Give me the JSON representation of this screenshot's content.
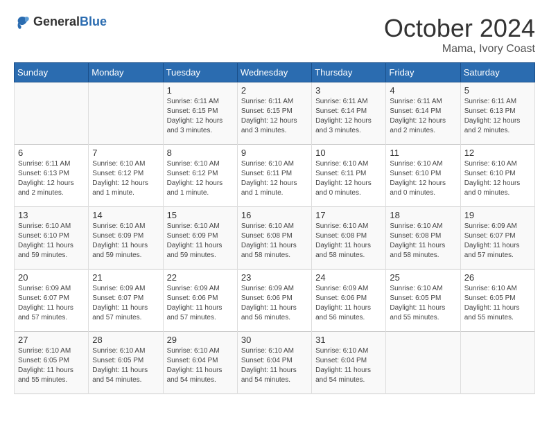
{
  "logo": {
    "general": "General",
    "blue": "Blue"
  },
  "header": {
    "month": "October 2024",
    "location": "Mama, Ivory Coast"
  },
  "days_of_week": [
    "Sunday",
    "Monday",
    "Tuesday",
    "Wednesday",
    "Thursday",
    "Friday",
    "Saturday"
  ],
  "weeks": [
    [
      {
        "day": "",
        "info": ""
      },
      {
        "day": "",
        "info": ""
      },
      {
        "day": "1",
        "info": "Sunrise: 6:11 AM\nSunset: 6:15 PM\nDaylight: 12 hours and 3 minutes."
      },
      {
        "day": "2",
        "info": "Sunrise: 6:11 AM\nSunset: 6:15 PM\nDaylight: 12 hours and 3 minutes."
      },
      {
        "day": "3",
        "info": "Sunrise: 6:11 AM\nSunset: 6:14 PM\nDaylight: 12 hours and 3 minutes."
      },
      {
        "day": "4",
        "info": "Sunrise: 6:11 AM\nSunset: 6:14 PM\nDaylight: 12 hours and 2 minutes."
      },
      {
        "day": "5",
        "info": "Sunrise: 6:11 AM\nSunset: 6:13 PM\nDaylight: 12 hours and 2 minutes."
      }
    ],
    [
      {
        "day": "6",
        "info": "Sunrise: 6:11 AM\nSunset: 6:13 PM\nDaylight: 12 hours and 2 minutes."
      },
      {
        "day": "7",
        "info": "Sunrise: 6:10 AM\nSunset: 6:12 PM\nDaylight: 12 hours and 1 minute."
      },
      {
        "day": "8",
        "info": "Sunrise: 6:10 AM\nSunset: 6:12 PM\nDaylight: 12 hours and 1 minute."
      },
      {
        "day": "9",
        "info": "Sunrise: 6:10 AM\nSunset: 6:11 PM\nDaylight: 12 hours and 1 minute."
      },
      {
        "day": "10",
        "info": "Sunrise: 6:10 AM\nSunset: 6:11 PM\nDaylight: 12 hours and 0 minutes."
      },
      {
        "day": "11",
        "info": "Sunrise: 6:10 AM\nSunset: 6:10 PM\nDaylight: 12 hours and 0 minutes."
      },
      {
        "day": "12",
        "info": "Sunrise: 6:10 AM\nSunset: 6:10 PM\nDaylight: 12 hours and 0 minutes."
      }
    ],
    [
      {
        "day": "13",
        "info": "Sunrise: 6:10 AM\nSunset: 6:10 PM\nDaylight: 11 hours and 59 minutes."
      },
      {
        "day": "14",
        "info": "Sunrise: 6:10 AM\nSunset: 6:09 PM\nDaylight: 11 hours and 59 minutes."
      },
      {
        "day": "15",
        "info": "Sunrise: 6:10 AM\nSunset: 6:09 PM\nDaylight: 11 hours and 59 minutes."
      },
      {
        "day": "16",
        "info": "Sunrise: 6:10 AM\nSunset: 6:08 PM\nDaylight: 11 hours and 58 minutes."
      },
      {
        "day": "17",
        "info": "Sunrise: 6:10 AM\nSunset: 6:08 PM\nDaylight: 11 hours and 58 minutes."
      },
      {
        "day": "18",
        "info": "Sunrise: 6:10 AM\nSunset: 6:08 PM\nDaylight: 11 hours and 58 minutes."
      },
      {
        "day": "19",
        "info": "Sunrise: 6:09 AM\nSunset: 6:07 PM\nDaylight: 11 hours and 57 minutes."
      }
    ],
    [
      {
        "day": "20",
        "info": "Sunrise: 6:09 AM\nSunset: 6:07 PM\nDaylight: 11 hours and 57 minutes."
      },
      {
        "day": "21",
        "info": "Sunrise: 6:09 AM\nSunset: 6:07 PM\nDaylight: 11 hours and 57 minutes."
      },
      {
        "day": "22",
        "info": "Sunrise: 6:09 AM\nSunset: 6:06 PM\nDaylight: 11 hours and 57 minutes."
      },
      {
        "day": "23",
        "info": "Sunrise: 6:09 AM\nSunset: 6:06 PM\nDaylight: 11 hours and 56 minutes."
      },
      {
        "day": "24",
        "info": "Sunrise: 6:09 AM\nSunset: 6:06 PM\nDaylight: 11 hours and 56 minutes."
      },
      {
        "day": "25",
        "info": "Sunrise: 6:10 AM\nSunset: 6:05 PM\nDaylight: 11 hours and 55 minutes."
      },
      {
        "day": "26",
        "info": "Sunrise: 6:10 AM\nSunset: 6:05 PM\nDaylight: 11 hours and 55 minutes."
      }
    ],
    [
      {
        "day": "27",
        "info": "Sunrise: 6:10 AM\nSunset: 6:05 PM\nDaylight: 11 hours and 55 minutes."
      },
      {
        "day": "28",
        "info": "Sunrise: 6:10 AM\nSunset: 6:05 PM\nDaylight: 11 hours and 54 minutes."
      },
      {
        "day": "29",
        "info": "Sunrise: 6:10 AM\nSunset: 6:04 PM\nDaylight: 11 hours and 54 minutes."
      },
      {
        "day": "30",
        "info": "Sunrise: 6:10 AM\nSunset: 6:04 PM\nDaylight: 11 hours and 54 minutes."
      },
      {
        "day": "31",
        "info": "Sunrise: 6:10 AM\nSunset: 6:04 PM\nDaylight: 11 hours and 54 minutes."
      },
      {
        "day": "",
        "info": ""
      },
      {
        "day": "",
        "info": ""
      }
    ]
  ]
}
